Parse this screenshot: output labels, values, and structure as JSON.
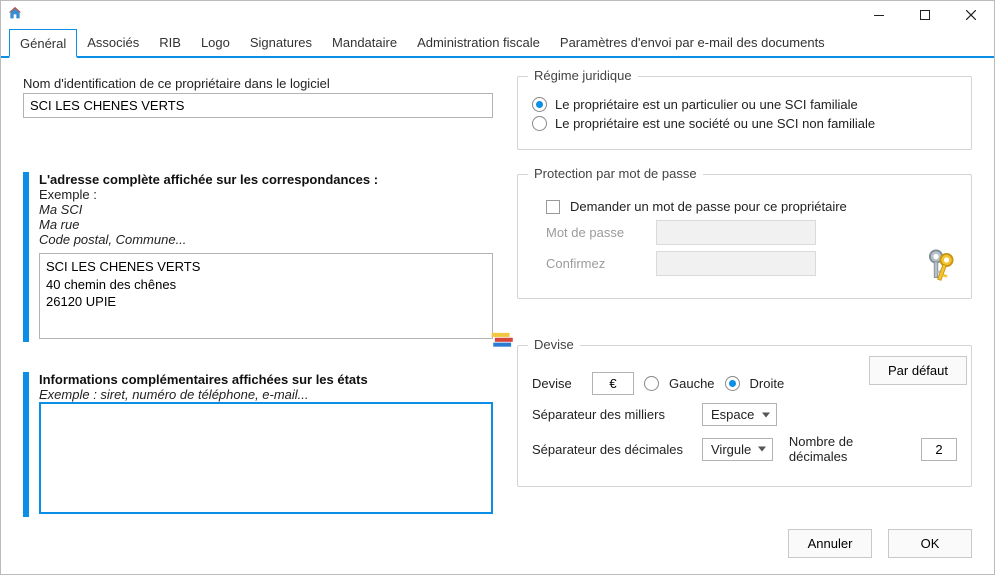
{
  "tabs": {
    "items": [
      {
        "label": "Général",
        "active": true
      },
      {
        "label": "Associés"
      },
      {
        "label": "RIB"
      },
      {
        "label": "Logo"
      },
      {
        "label": "Signatures"
      },
      {
        "label": "Mandataire"
      },
      {
        "label": "Administration fiscale"
      },
      {
        "label": "Paramètres d'envoi par e-mail des documents"
      }
    ]
  },
  "ident": {
    "label": "Nom d'identification de ce propriétaire dans le logiciel",
    "value": "SCI LES CHENES VERTS"
  },
  "regime": {
    "legend": "Régime juridique",
    "opt1": "Le propriétaire est un particulier ou une SCI familiale",
    "opt2": "Le propriétaire est une société ou une SCI non familiale",
    "selected": 1
  },
  "address": {
    "title": "L'adresse complète affichée sur les correspondances :",
    "example_label": "Exemple :",
    "example_l1": "Ma SCI",
    "example_l2": "Ma rue",
    "example_l3": "Code postal, Commune...",
    "value": "SCI LES CHENES VERTS\n40 chemin des chênes\n26120 UPIE"
  },
  "protection": {
    "legend": "Protection par mot de passe",
    "checkbox_label": "Demander un mot de passe pour ce propriétaire",
    "checked": false,
    "pw_label": "Mot de passe",
    "confirm_label": "Confirmez",
    "pw_value": "",
    "confirm_value": ""
  },
  "extra": {
    "title": "Informations complémentaires affichées sur les états",
    "hint": "Exemple : siret, numéro de téléphone, e-mail...",
    "value": ""
  },
  "devise": {
    "legend": "Devise",
    "default_btn": "Par défaut",
    "label_devise": "Devise",
    "symbol": "€",
    "side_left": "Gauche",
    "side_right": "Droite",
    "side_selected": "right",
    "label_thousands": "Séparateur des milliers",
    "thousands_value": "Espace",
    "label_decimals_sep": "Séparateur des décimales",
    "decimals_sep_value": "Virgule",
    "label_decimals_count": "Nombre de décimales",
    "decimals_count": "2"
  },
  "footer": {
    "cancel": "Annuler",
    "ok": "OK"
  }
}
